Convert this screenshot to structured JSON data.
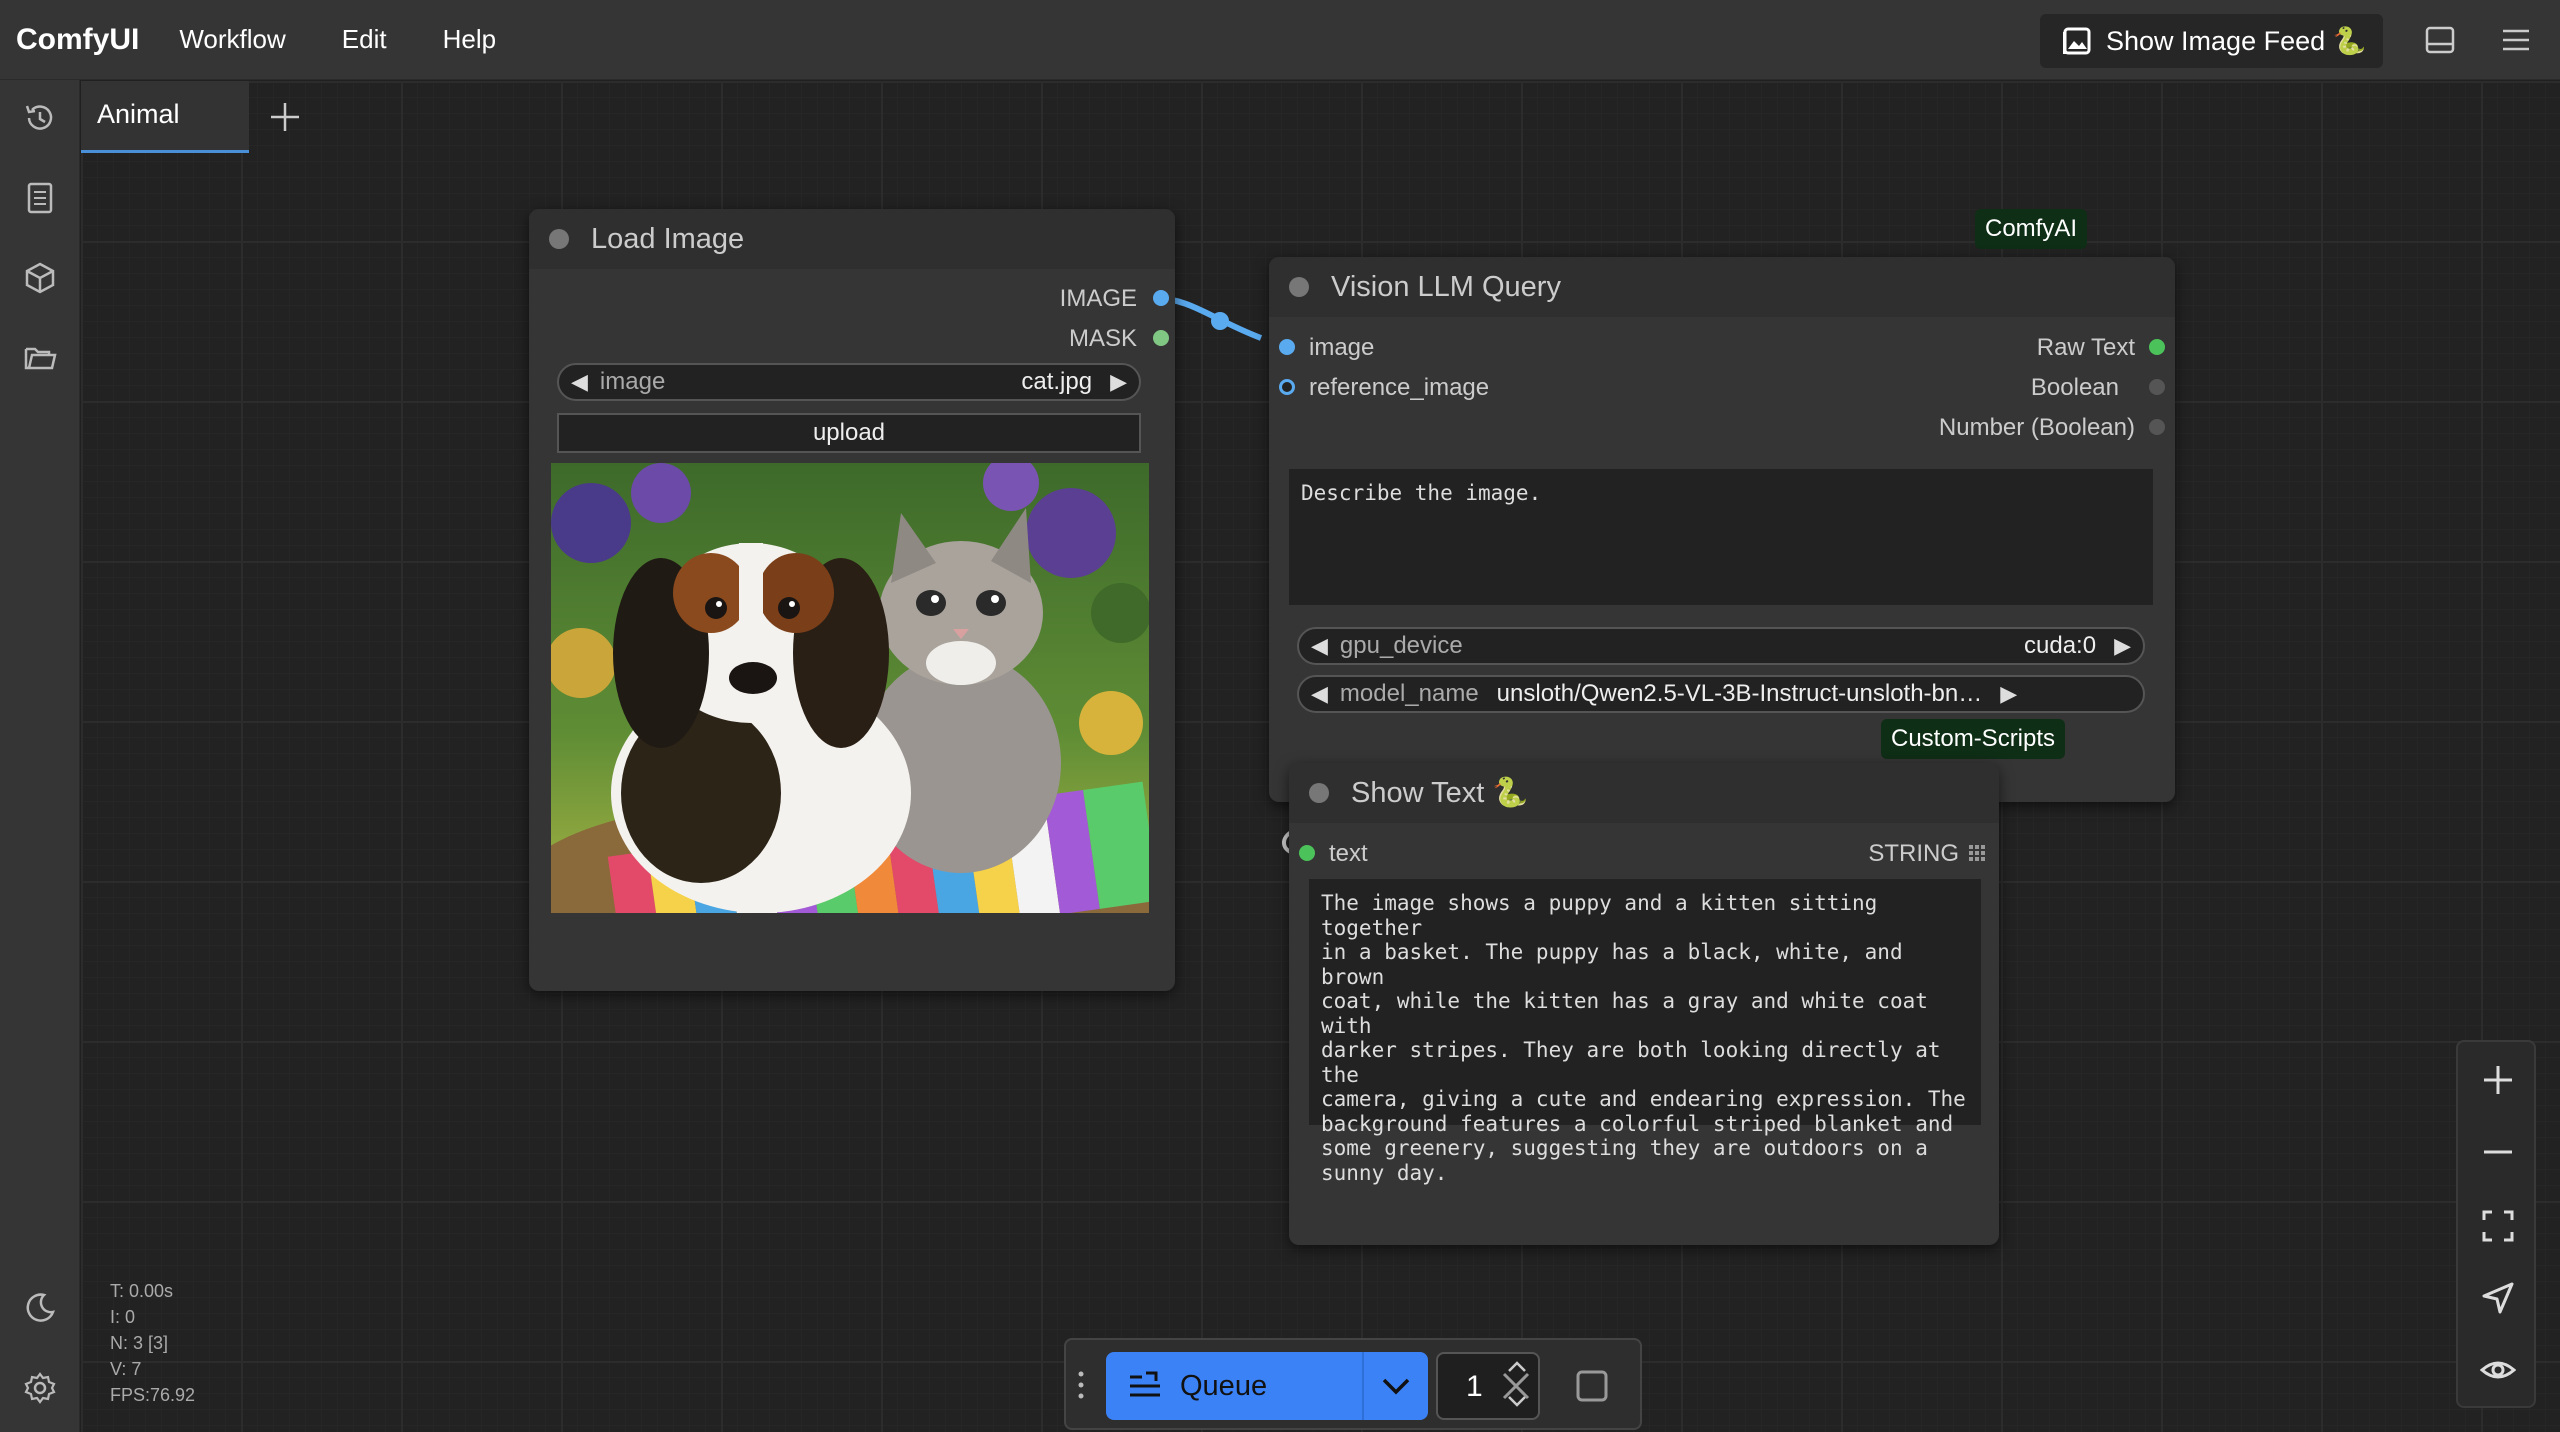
{
  "app": {
    "brand": "ComfyUI",
    "menu": [
      "Workflow",
      "Edit",
      "Help"
    ],
    "show_feed_label": "Show Image Feed 🐍"
  },
  "sidebar": {
    "icons": [
      "history-icon",
      "document-icon",
      "cube-icon",
      "folder-icon",
      "moon-icon",
      "settings-icon"
    ]
  },
  "tabs": [
    {
      "label": "Animal",
      "active": true
    }
  ],
  "nodes": {
    "load_image": {
      "title": "Load Image",
      "outputs": [
        "IMAGE",
        "MASK"
      ],
      "image_widget": {
        "name": "image",
        "value": "cat.jpg"
      },
      "upload_label": "upload"
    },
    "vision_llm": {
      "title": "Vision LLM Query",
      "badge": "ComfyAI",
      "inputs": [
        "image",
        "reference_image"
      ],
      "outputs": [
        "Raw Text",
        "Boolean",
        "Number (Boolean)"
      ],
      "prompt": "Describe the image.",
      "gpu_device": {
        "name": "gpu_device",
        "value": "cuda:0"
      },
      "model_name": {
        "name": "model_name",
        "value": "unsloth/Qwen2.5-VL-3B-Instruct-unsloth-bn…"
      }
    },
    "show_text": {
      "title": "Show Text 🐍",
      "badge": "Custom-Scripts",
      "input": "text",
      "output": "STRING",
      "text": "The image shows a puppy and a kitten sitting together\nin a basket. The puppy has a black, white, and brown\ncoat, while the kitten has a gray and white coat with\ndarker stripes. They are both looking directly at the\ncamera, giving a cute and endearing expression. The\nbackground features a colorful striped blanket and\nsome greenery, suggesting they are outdoors on a\nsunny day."
    }
  },
  "stats": {
    "t": "T: 0.00s",
    "i": "I: 0",
    "n": "N: 3 [3]",
    "v": "V: 7",
    "fps": "FPS:76.92"
  },
  "queue": {
    "label": "Queue",
    "count": "1"
  },
  "colors": {
    "accent": "#3b82f6",
    "image_slot": "#5aaaf0",
    "mask_slot": "#81c784",
    "string_slot": "#4cc25a",
    "badge_bg": "#0f2e16"
  }
}
